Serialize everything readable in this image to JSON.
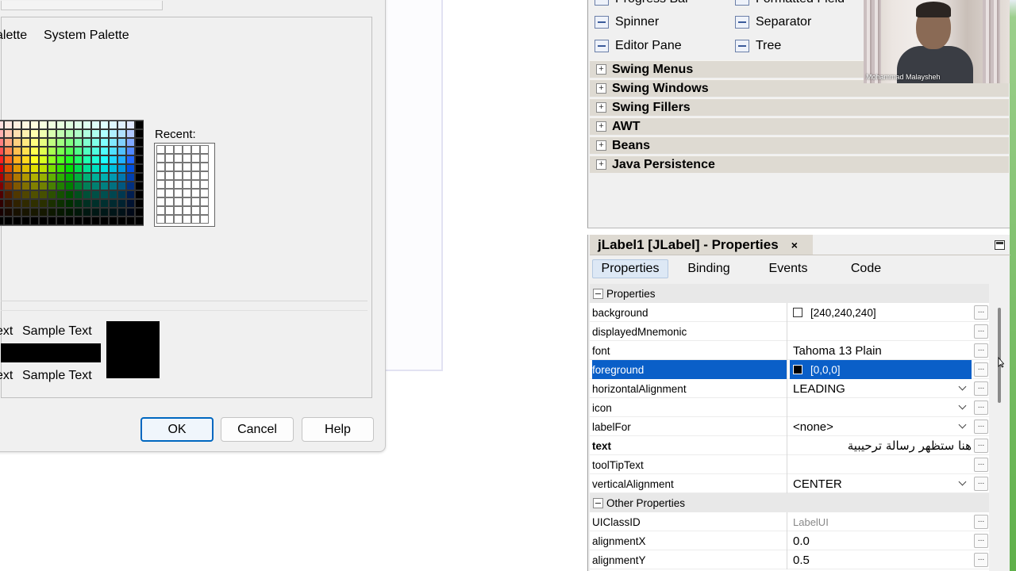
{
  "dialog": {
    "tabs": [
      "alette",
      "System Palette"
    ],
    "recent_label": "Recent:",
    "sample_text_partial": "ext",
    "sample_text": "Sample Text",
    "buttons": {
      "ok": "OK",
      "cancel": "Cancel",
      "help": "Help"
    },
    "swatch_colors": [
      [
        "#ffe0e0",
        "#ffe8e0",
        "#fff0e0",
        "#fff8e0",
        "#ffffe0",
        "#f8ffe0",
        "#f0ffe0",
        "#e8ffe0",
        "#e0ffe0",
        "#e0ffe8",
        "#e0fff0",
        "#e0fff8",
        "#e0ffff",
        "#e0f8ff",
        "#e0f0ff",
        "#e0e8ff",
        "#000000"
      ],
      [
        "#ffb0b0",
        "#ffc8b0",
        "#ffe0b0",
        "#fff0b0",
        "#ffffb0",
        "#f0ffb0",
        "#d8ffb0",
        "#c0ffb0",
        "#b0ffb0",
        "#b0ffc8",
        "#b0ffe0",
        "#b0fff0",
        "#b0ffff",
        "#b0f0ff",
        "#b0e0ff",
        "#b0c8ff",
        "#000000"
      ],
      [
        "#ff8080",
        "#ffa880",
        "#ffd080",
        "#ffe880",
        "#ffff80",
        "#e8ff80",
        "#c0ff80",
        "#a0ff80",
        "#80ff80",
        "#80ffa8",
        "#80ffd0",
        "#80ffe8",
        "#80ffff",
        "#80e8ff",
        "#80d0ff",
        "#80a8ff",
        "#000000"
      ],
      [
        "#ff5050",
        "#ff8850",
        "#ffc050",
        "#ffe050",
        "#ffff50",
        "#e0ff50",
        "#a8ff50",
        "#78ff50",
        "#50ff50",
        "#50ff88",
        "#50ffc0",
        "#50ffe0",
        "#50ffff",
        "#50e0ff",
        "#50c0ff",
        "#5088ff",
        "#000000"
      ],
      [
        "#ff2020",
        "#ff6820",
        "#ffb020",
        "#ffd820",
        "#ffff20",
        "#d8ff20",
        "#90ff20",
        "#50ff20",
        "#20ff20",
        "#20ff68",
        "#20ffb0",
        "#20ffd8",
        "#20ffff",
        "#20d8ff",
        "#20b0ff",
        "#2068ff",
        "#000000"
      ],
      [
        "#e00000",
        "#e05000",
        "#e09800",
        "#e0c000",
        "#e0e000",
        "#c0e000",
        "#78e000",
        "#38e000",
        "#00e000",
        "#00e050",
        "#00e098",
        "#00e0c0",
        "#00e0e0",
        "#00c0e0",
        "#0098e0",
        "#0050e0",
        "#000000"
      ],
      [
        "#b00000",
        "#b04000",
        "#b07800",
        "#b09800",
        "#b0b000",
        "#98b000",
        "#60b000",
        "#2cb000",
        "#00b000",
        "#00b040",
        "#00b078",
        "#00b098",
        "#00b0b0",
        "#0098b0",
        "#0078b0",
        "#0040b0",
        "#000000"
      ],
      [
        "#800000",
        "#803000",
        "#805800",
        "#807000",
        "#808000",
        "#708000",
        "#488000",
        "#208000",
        "#008000",
        "#008030",
        "#008058",
        "#008070",
        "#008080",
        "#007080",
        "#005880",
        "#003080",
        "#000000"
      ],
      [
        "#500000",
        "#501e00",
        "#503800",
        "#504600",
        "#505000",
        "#465000",
        "#2c5000",
        "#145000",
        "#005000",
        "#00501e",
        "#005038",
        "#005046",
        "#005050",
        "#004650",
        "#003850",
        "#001e50",
        "#000000"
      ],
      [
        "#300000",
        "#301200",
        "#302200",
        "#302a00",
        "#303000",
        "#2a3000",
        "#1a3000",
        "#0c3000",
        "#003000",
        "#003012",
        "#003022",
        "#00302a",
        "#003030",
        "#002a30",
        "#002230",
        "#001230",
        "#000000"
      ],
      [
        "#180000",
        "#180900",
        "#181100",
        "#181500",
        "#181800",
        "#151800",
        "#0d1800",
        "#061800",
        "#001800",
        "#001809",
        "#001811",
        "#001815",
        "#001818",
        "#001518",
        "#001118",
        "#000918",
        "#000000"
      ],
      [
        "#000000",
        "#000000",
        "#000000",
        "#000000",
        "#000000",
        "#000000",
        "#000000",
        "#000000",
        "#000000",
        "#000000",
        "#000000",
        "#000000",
        "#000000",
        "#000000",
        "#000000",
        "#000000",
        "#000000"
      ]
    ]
  },
  "palette": {
    "items": [
      {
        "label": "Progress Bar",
        "icon": "progress-bar-icon"
      },
      {
        "label": "Formatted Field",
        "icon": "formatted-field-icon"
      },
      {
        "label": "Spinner",
        "icon": "spinner-icon"
      },
      {
        "label": "Separator",
        "icon": "separator-icon"
      },
      {
        "label": "Editor Pane",
        "icon": "editor-pane-icon"
      },
      {
        "label": "Tree",
        "icon": "tree-icon"
      }
    ],
    "categories": [
      "Swing Menus",
      "Swing Windows",
      "Swing Fillers",
      "AWT",
      "Beans",
      "Java Persistence"
    ]
  },
  "video": {
    "name": "Mohammad Malaysheh"
  },
  "properties": {
    "title": "jLabel1 [JLabel] - Properties",
    "close": "×",
    "tabs": [
      "Properties",
      "Binding",
      "Events",
      "Code"
    ],
    "sections": [
      "Properties",
      "Other Properties"
    ],
    "rows": [
      {
        "name": "background",
        "value": "[240,240,240]"
      },
      {
        "name": "displayedMnemonic",
        "value": ""
      },
      {
        "name": "font",
        "value": "Tahoma 13 Plain"
      },
      {
        "name": "foreground",
        "value": "[0,0,0]"
      },
      {
        "name": "horizontalAlignment",
        "value": "LEADING"
      },
      {
        "name": "icon",
        "value": ""
      },
      {
        "name": "labelFor",
        "value": "<none>"
      },
      {
        "name": "text",
        "value": "هنا ستظهر رسالة ترحيبية"
      },
      {
        "name": "toolTipText",
        "value": ""
      },
      {
        "name": "verticalAlignment",
        "value": "CENTER"
      }
    ],
    "other_rows": [
      {
        "name": "UIClassID",
        "value": "LabelUI"
      },
      {
        "name": "alignmentX",
        "value": "0.0"
      },
      {
        "name": "alignmentY",
        "value": "0.5"
      }
    ],
    "colors": {
      "selection": "#0a5fc8"
    }
  }
}
